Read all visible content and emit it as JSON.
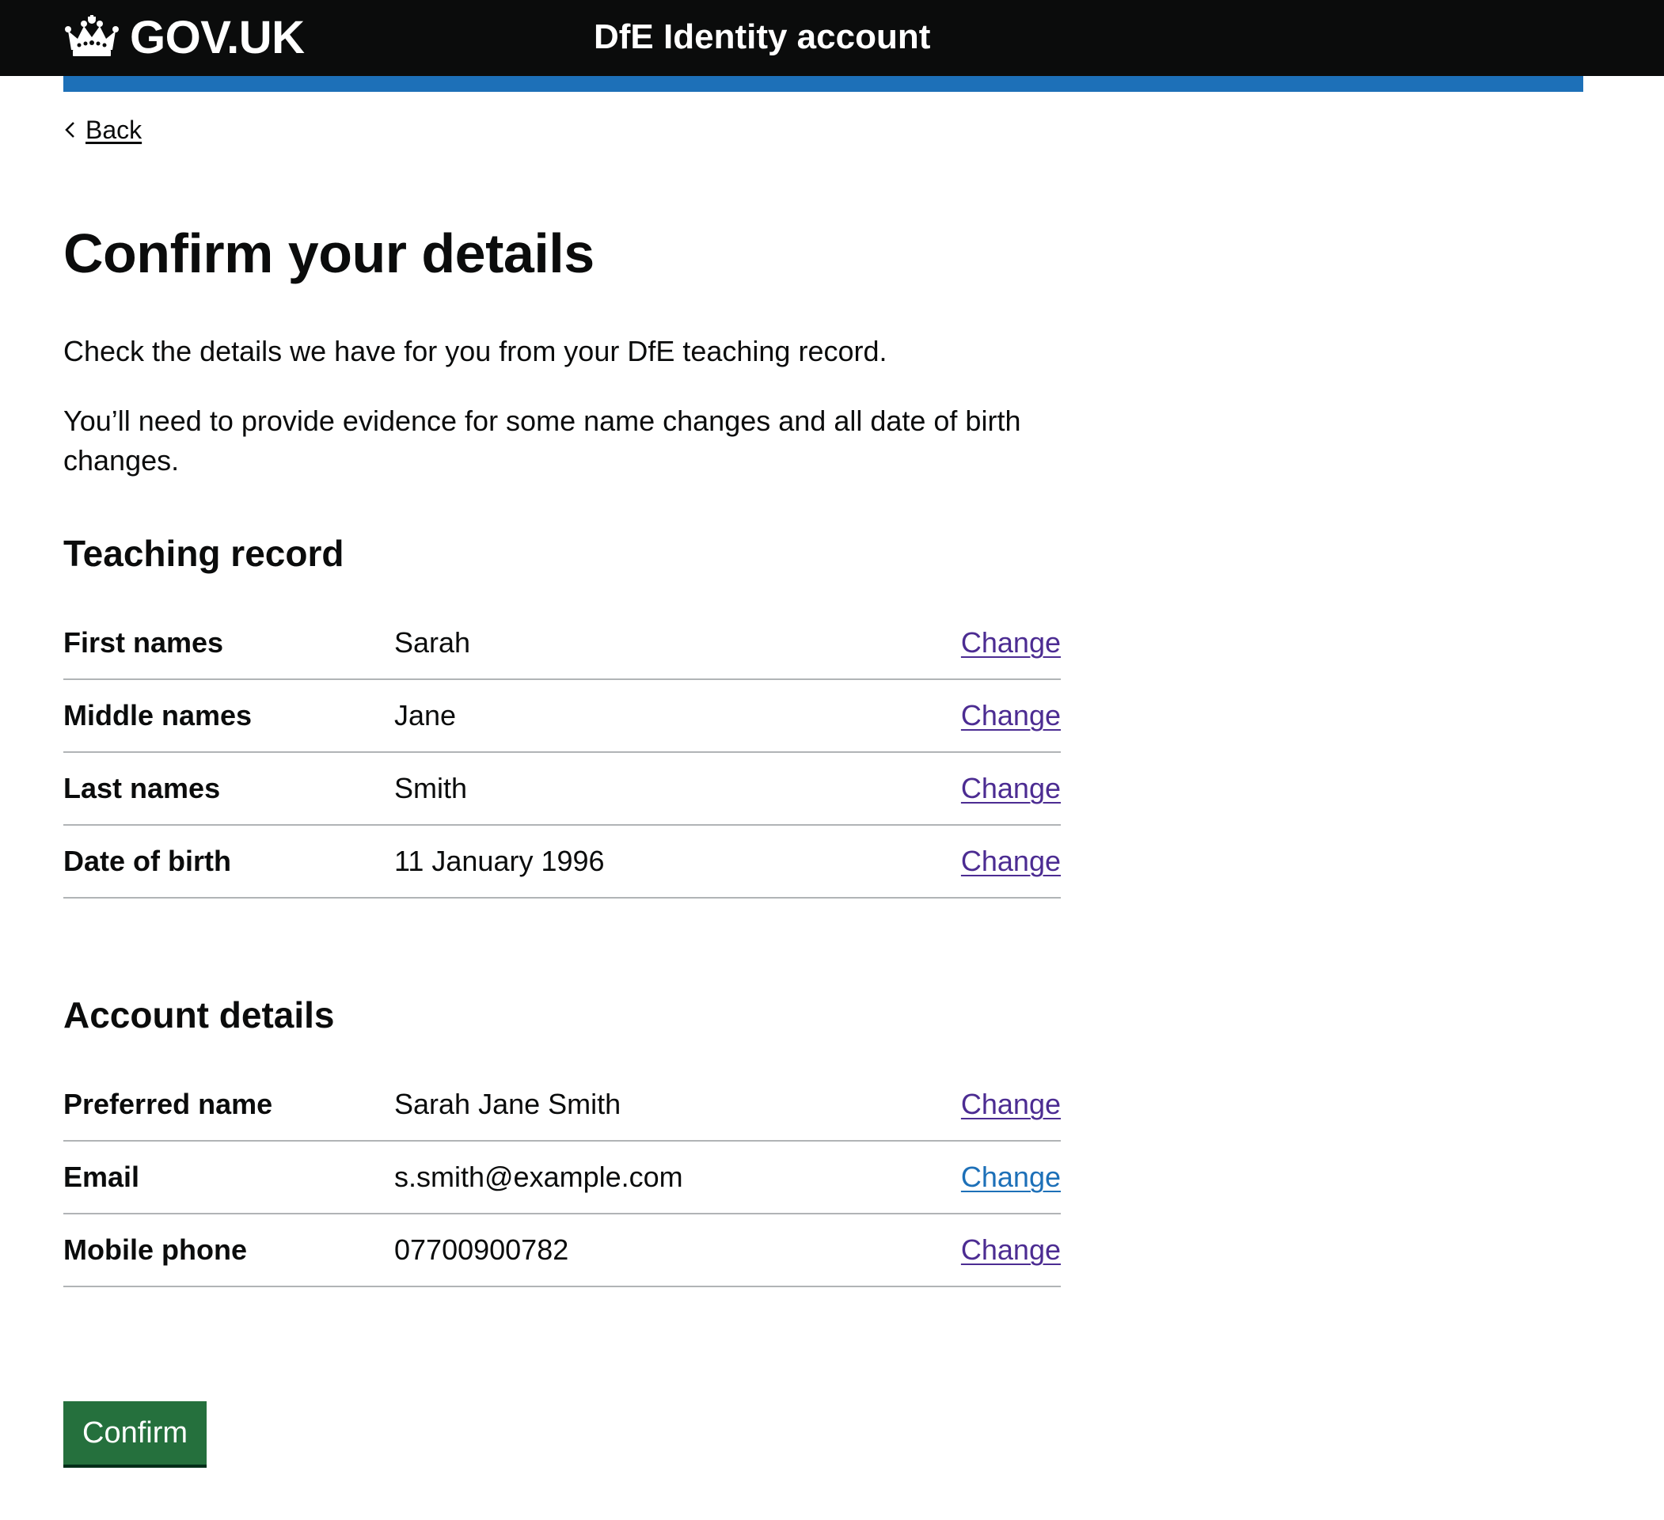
{
  "header": {
    "logo_text": "GOV.UK",
    "service_name": "DfE Identity account",
    "crown_icon": "crown-icon"
  },
  "colors": {
    "header_bg": "#0b0c0c",
    "accent_bar": "#1d70b8",
    "link_visited": "#4c2c92",
    "link": "#1d70b8",
    "button_green": "#25703d"
  },
  "back": {
    "label": "Back"
  },
  "page": {
    "title": "Confirm your details",
    "paragraph_1": "Check the details we have for you from your DfE teaching record.",
    "paragraph_2": "You’ll need to provide evidence for some name changes and all date of birth changes."
  },
  "teaching_record": {
    "heading": "Teaching record",
    "rows": [
      {
        "key": "First names",
        "value": "Sarah",
        "action": "Change"
      },
      {
        "key": "Middle names",
        "value": "Jane",
        "action": "Change"
      },
      {
        "key": "Last names",
        "value": "Smith",
        "action": "Change"
      },
      {
        "key": "Date of birth",
        "value": "11 January 1996",
        "action": "Change"
      }
    ]
  },
  "account_details": {
    "heading": "Account details",
    "rows": [
      {
        "key": "Preferred name",
        "value": "Sarah Jane Smith",
        "action": "Change"
      },
      {
        "key": "Email",
        "value": "s.smith@example.com",
        "action": "Change"
      },
      {
        "key": "Mobile phone",
        "value": "07700900782",
        "action": "Change"
      }
    ]
  },
  "confirm_button": {
    "label": "Confirm"
  }
}
